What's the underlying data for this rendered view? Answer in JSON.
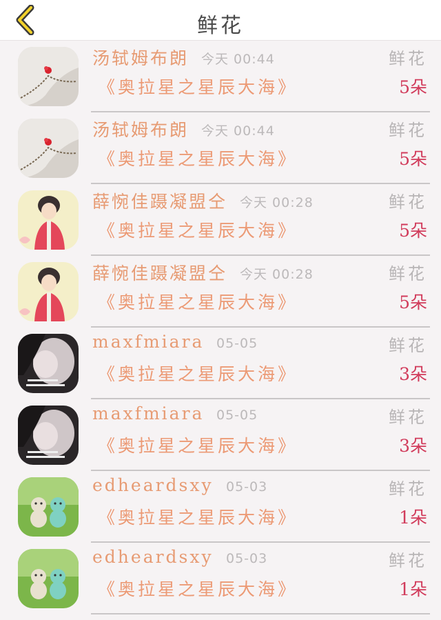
{
  "header": {
    "title": "鲜花"
  },
  "rows": [
    {
      "name": "汤轼姆布朗",
      "time": "今天 00:44",
      "gift": "鲜花",
      "room": "《奥拉星之星辰大海》",
      "count": "5朵",
      "avatar": "lace-rose-icon"
    },
    {
      "name": "汤轼姆布朗",
      "time": "今天 00:44",
      "gift": "鲜花",
      "room": "《奥拉星之星辰大海》",
      "count": "5朵",
      "avatar": "lace-rose-icon"
    },
    {
      "name": "薛惋佳蹑凝盟仝",
      "time": "今天 00:28",
      "gift": "鲜花",
      "room": "《奥拉星之星辰大海》",
      "count": "5朵",
      "avatar": "anime-boy-icon"
    },
    {
      "name": "薛惋佳蹑凝盟仝",
      "time": "今天 00:28",
      "gift": "鲜花",
      "room": "《奥拉星之星辰大海》",
      "count": "5朵",
      "avatar": "anime-boy-icon"
    },
    {
      "name": "maxfmiara",
      "time": "05-05",
      "gift": "鲜花",
      "room": "《奥拉星之星辰大海》",
      "count": "3朵",
      "avatar": "girl-photo-icon"
    },
    {
      "name": "maxfmiara",
      "time": "05-05",
      "gift": "鲜花",
      "room": "《奥拉星之星辰大海》",
      "count": "3朵",
      "avatar": "girl-photo-icon"
    },
    {
      "name": "edheardsxy",
      "time": "05-03",
      "gift": "鲜花",
      "room": "《奥拉星之星辰大海》",
      "count": "1朵",
      "avatar": "teddy-bears-icon"
    },
    {
      "name": "edheardsxy",
      "time": "05-03",
      "gift": "鲜花",
      "room": "《奥拉星之星辰大海》",
      "count": "1朵",
      "avatar": "teddy-bears-icon"
    }
  ]
}
